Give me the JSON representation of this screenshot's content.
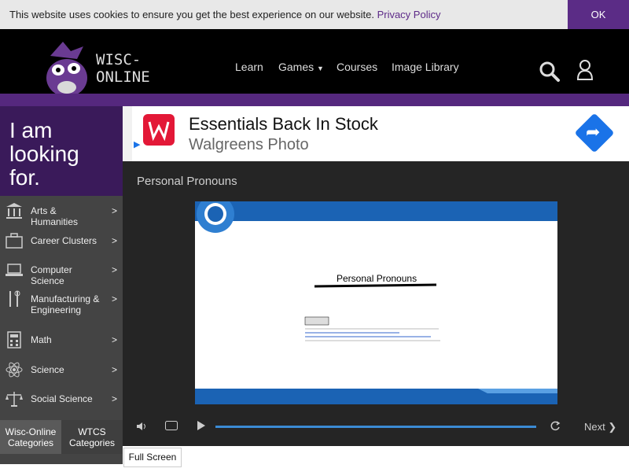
{
  "cookie": {
    "text": "This website uses cookies to ensure you get the best experience on our website.",
    "link": "Privacy Policy",
    "ok": "OK"
  },
  "header": {
    "logo_text": "WISC-ONLINE",
    "nav": [
      "Learn",
      "Games",
      "Courses",
      "Image Library"
    ]
  },
  "sidebar": {
    "looking": "I am looking for.",
    "categories": [
      {
        "label": "Arts & Humanities",
        "icon": "columns-icon"
      },
      {
        "label": "Career Clusters",
        "icon": "briefcase-icon"
      },
      {
        "label": "Computer Science",
        "icon": "laptop-icon"
      },
      {
        "label": "Manufacturing & Engineering",
        "icon": "tools-icon"
      },
      {
        "label": "Math",
        "icon": "calculator-icon"
      },
      {
        "label": "Science",
        "icon": "atom-icon"
      },
      {
        "label": "Social Science",
        "icon": "scales-icon"
      }
    ],
    "arrow": ">",
    "tabs": [
      "Wisc-Online Categories",
      "WTCS Categories"
    ]
  },
  "ad": {
    "title": "Essentials Back In Stock",
    "subtitle": "Walgreens Photo"
  },
  "player": {
    "title": "Personal Pronouns",
    "slide_heading": "Personal Pronouns",
    "next": "Next"
  },
  "fullscreen": "Full Screen",
  "colors": {
    "purple": "#5b2c86",
    "accent_blue": "#3b8bd4",
    "black": "#000000"
  }
}
